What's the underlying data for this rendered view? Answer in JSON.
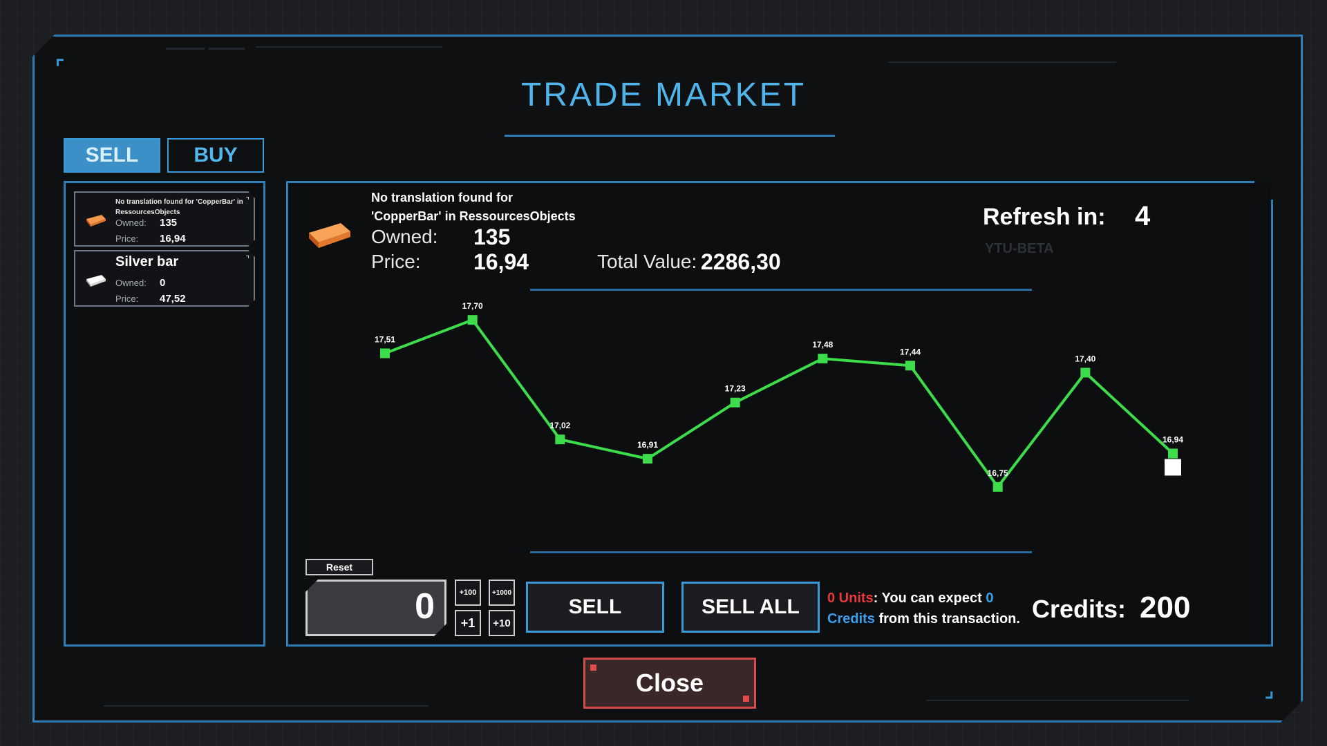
{
  "title": "TRADE MARKET",
  "tabs": {
    "sell": "SELL",
    "buy": "BUY"
  },
  "items": [
    {
      "name": "No translation found for 'CopperBar' in RessourcesObjects",
      "owned_label": "Owned:",
      "owned": "135",
      "price_label": "Price:",
      "price": "16,94",
      "icon": "copper-ingot-icon",
      "color": "#f07b2e"
    },
    {
      "name": "Silver bar",
      "owned_label": "Owned:",
      "owned": "0",
      "price_label": "Price:",
      "price": "47,52",
      "icon": "silver-ingot-icon",
      "color": "#e8e8e8"
    }
  ],
  "detail": {
    "name_line1": "No translation found for",
    "name_line2": "'CopperBar' in RessourcesObjects",
    "owned_label": "Owned:",
    "owned": "135",
    "price_label": "Price:",
    "price": "16,94",
    "total_label": "Total Value:",
    "total": "2286,30",
    "refresh_label": "Refresh in:",
    "refresh": "4",
    "build_tag": "YTU-BETA"
  },
  "chart_data": {
    "type": "line",
    "x": [
      1,
      2,
      3,
      4,
      5,
      6,
      7,
      8,
      9,
      10
    ],
    "labels": [
      "17,51",
      "17,70",
      "17,02",
      "16,91",
      "17,23",
      "17,48",
      "17,44",
      "16,75",
      "17,40",
      "16,94"
    ],
    "values": [
      17.51,
      17.7,
      17.02,
      16.91,
      17.23,
      17.48,
      17.44,
      16.75,
      17.4,
      16.94
    ],
    "ylim": [
      16.6,
      17.85
    ],
    "grid": false,
    "line_color": "#3ddc4a",
    "current_marker_color": "#ffffff"
  },
  "controls": {
    "reset": "Reset",
    "quantity": "0",
    "steps": [
      "+100",
      "+1000",
      "+1",
      "+10"
    ],
    "sell": "SELL",
    "sell_all": "SELL ALL",
    "units_text": "0 Units",
    "expect_text": ": You can expect ",
    "expect_value": "0",
    "credits_word": "Credits",
    "from_text": " from this transaction.",
    "credits_label": "Credits:",
    "credits": "200"
  },
  "close": "Close"
}
